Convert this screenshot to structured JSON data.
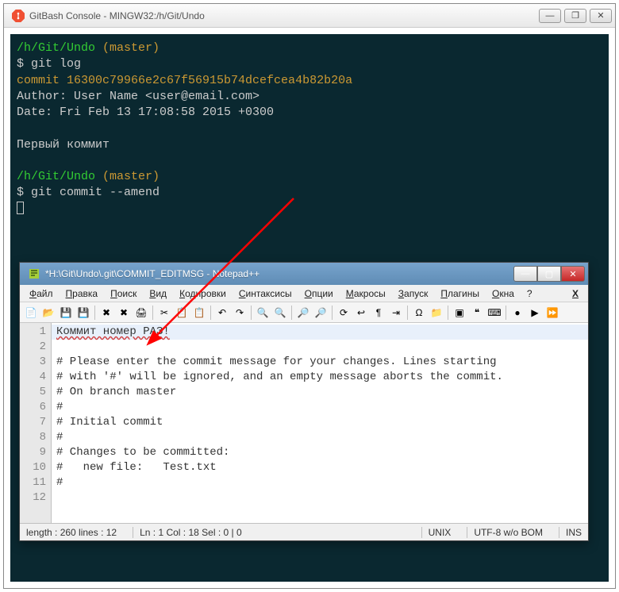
{
  "gitbash": {
    "title": "GitBash Console - MINGW32:/h/Git/Undo",
    "lines": {
      "prompt1_path": "/h/Git/Undo",
      "prompt1_branch": "(master)",
      "cmd1_prefix": "$ ",
      "cmd1": "git log",
      "commit_label": "commit ",
      "commit_hash": "16300c79966e2c67f56915b74dcefcea4b82b20a",
      "author": "Author: User Name <user@email.com>",
      "date": "Date:   Fri Feb 13 17:08:58 2015 +0300",
      "msg": "    Первый коммит",
      "prompt2_path": "/h/Git/Undo",
      "prompt2_branch": "(master)",
      "cmd2_prefix": "$ ",
      "cmd2": "git commit --amend"
    },
    "winbtns": {
      "min": "—",
      "max": "❐",
      "close": "✕"
    }
  },
  "npp": {
    "title": "*H:\\Git\\Undo\\.git\\COMMIT_EDITMSG - Notepad++",
    "menu": [
      "Файл",
      "Правка",
      "Поиск",
      "Вид",
      "Кодировки",
      "Синтаксисы",
      "Опции",
      "Макросы",
      "Запуск",
      "Плагины",
      "Окна",
      "?"
    ],
    "menu_close": "X",
    "lines": [
      {
        "n": "1",
        "t": "Коммит номер РАЗ!",
        "hl": true,
        "wavy": true
      },
      {
        "n": "2",
        "t": ""
      },
      {
        "n": "3",
        "t": "# Please enter the commit message for your changes. Lines starting"
      },
      {
        "n": "4",
        "t": "# with '#' will be ignored, and an empty message aborts the commit."
      },
      {
        "n": "5",
        "t": "# On branch master"
      },
      {
        "n": "6",
        "t": "#"
      },
      {
        "n": "7",
        "t": "# Initial commit"
      },
      {
        "n": "8",
        "t": "#"
      },
      {
        "n": "9",
        "t": "# Changes to be committed:"
      },
      {
        "n": "10",
        "t": "#   new file:   Test.txt"
      },
      {
        "n": "11",
        "t": "#"
      },
      {
        "n": "12",
        "t": ""
      }
    ],
    "status": {
      "len": "length : 260    lines : 12",
      "pos": "Ln : 1   Col : 18   Sel : 0 | 0",
      "eol": "UNIX",
      "enc": "UTF-8 w/o BOM",
      "ins": "INS"
    },
    "winbtns": {
      "min": "—",
      "max": "▢",
      "close": "✕"
    },
    "tool_icons": [
      "new",
      "open",
      "save",
      "save-all",
      "close",
      "close-all",
      "print",
      "cut",
      "copy",
      "paste",
      "undo",
      "redo",
      "find",
      "replace",
      "zoom-in",
      "zoom-out",
      "sync",
      "wrap",
      "ws",
      "indent",
      "lang",
      "dir",
      "folding",
      "comment",
      "autocomplete",
      "macro-rec",
      "macro-play",
      "macro-multi"
    ]
  },
  "colors": {
    "term_bg": "#0a2830",
    "term_green": "#33cc33",
    "term_yellow": "#cc9933",
    "arrow": "#ff0000"
  }
}
